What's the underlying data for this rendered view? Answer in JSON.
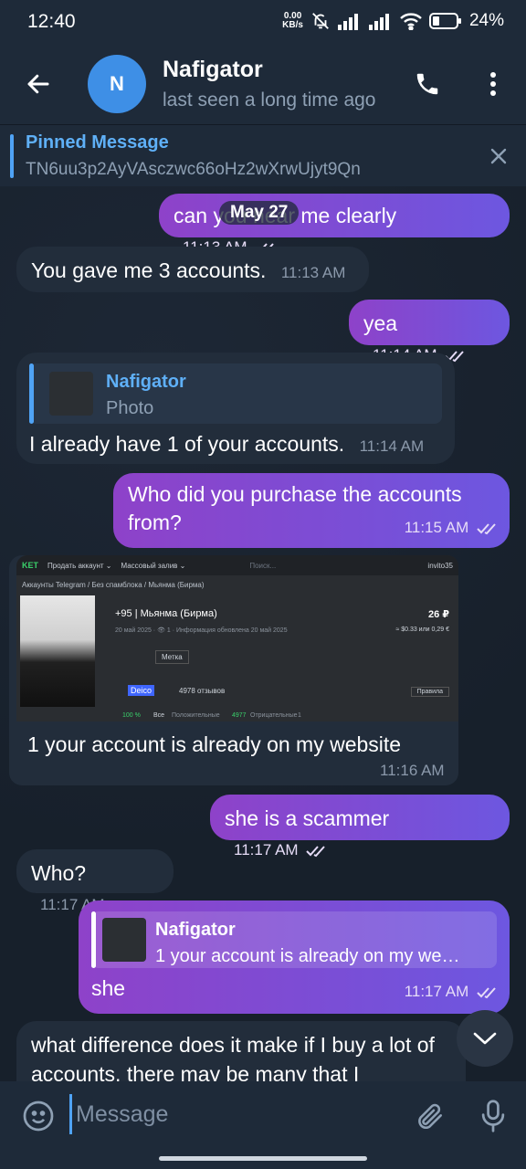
{
  "status_bar": {
    "time": "12:40",
    "net_speed_value": "0.00",
    "net_speed_unit": "KB/s",
    "battery": "24%"
  },
  "header": {
    "avatar_letter": "N",
    "name": "Nafigator",
    "status": "last seen a long time ago"
  },
  "pinned": {
    "title": "Pinned Message",
    "text": "TN6uu3p2AyVAsczwc66oHz2wXrwUjyt9Qn"
  },
  "date_chip": "May 27",
  "messages": [
    {
      "dir": "out",
      "text": "can you hear me clearly",
      "time": "11:13 AM"
    },
    {
      "dir": "in",
      "text": "You gave me 3 accounts.",
      "time": "11:13 AM"
    },
    {
      "dir": "out",
      "text": "yea",
      "time": "11:14 AM"
    },
    {
      "dir": "in",
      "reply_name": "Nafigator",
      "reply_sub": "Photo",
      "text": "I already have 1 of your accounts.",
      "time": "11:14 AM"
    },
    {
      "dir": "out",
      "text": "Who did you purchase the accounts from?",
      "time": "11:15 AM"
    },
    {
      "dir": "in",
      "photo": true,
      "text": "1 your account is already on my website",
      "time": "11:16 AM"
    },
    {
      "dir": "out",
      "text": "she is a scammer",
      "time": "11:17 AM"
    },
    {
      "dir": "in",
      "text": "Who?",
      "time": "11:17 AM"
    },
    {
      "dir": "out",
      "reply_name": "Nafigator",
      "reply_sub": "1 your account is already on my we…",
      "text": "she",
      "time": "11:17 AM"
    },
    {
      "dir": "in",
      "text": "what difference does it make if I buy a lot of accounts, there may be many that I"
    }
  ],
  "photo_content": {
    "logo": "KET",
    "menu_1": "Продать аккаунт ⌄",
    "menu_2": "Массовый залив ⌄",
    "search": "Поиск...",
    "user": "invito35",
    "crumbs": "Аккаунты Telegram / Без спамблока / Мьянма (Бирма)",
    "title": "+95 | Мьянма (Бирма)",
    "price": "26 ₽",
    "date_line": "20 май 2025 · 👁 1 · Информация обновлена 20 май 2025",
    "price_sub": "≈ $0.33 или 0,29 €",
    "tag": "Метка",
    "seller": "Deico",
    "reviews": "4978 отзывов",
    "rules": "Правила",
    "rating": "100 %",
    "tab_all": "Все",
    "tab_pos": "Положительные",
    "tab_pos_count": "4977",
    "tab_neg": "Отрицательные",
    "tab_neg_count": "1"
  },
  "input": {
    "placeholder": "Message"
  }
}
